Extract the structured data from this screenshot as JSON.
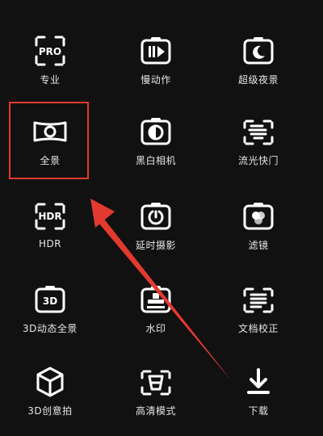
{
  "modes": [
    {
      "id": "pro",
      "label": "专业",
      "icon": "pro-icon"
    },
    {
      "id": "slowmo",
      "label": "慢动作",
      "icon": "slow-motion-icon"
    },
    {
      "id": "supernight",
      "label": "超级夜景",
      "icon": "night-icon"
    },
    {
      "id": "panorama",
      "label": "全景",
      "icon": "panorama-icon"
    },
    {
      "id": "bw",
      "label": "黑白相机",
      "icon": "bw-camera-icon"
    },
    {
      "id": "lightpainting",
      "label": "流光快门",
      "icon": "light-painting-icon"
    },
    {
      "id": "hdr",
      "label": "HDR",
      "icon": "hdr-icon"
    },
    {
      "id": "timelapse",
      "label": "延时摄影",
      "icon": "timelapse-icon"
    },
    {
      "id": "filter",
      "label": "滤镜",
      "icon": "filter-icon"
    },
    {
      "id": "3dpanorama",
      "label": "3D动态全景",
      "icon": "3d-icon"
    },
    {
      "id": "watermark",
      "label": "水印",
      "icon": "watermark-icon"
    },
    {
      "id": "docscan",
      "label": "文档校正",
      "icon": "document-icon"
    },
    {
      "id": "3dcreate",
      "label": "3D创意拍",
      "icon": "cube-icon"
    },
    {
      "id": "hires",
      "label": "高清模式",
      "icon": "hires-icon"
    },
    {
      "id": "download",
      "label": "下载",
      "icon": "download-icon"
    }
  ],
  "highlight": {
    "target": "panorama",
    "color": "#e33a2f"
  },
  "arrow": {
    "color": "#e33a2f"
  },
  "theme": {
    "background": "#111111",
    "foreground": "#ffffff"
  }
}
